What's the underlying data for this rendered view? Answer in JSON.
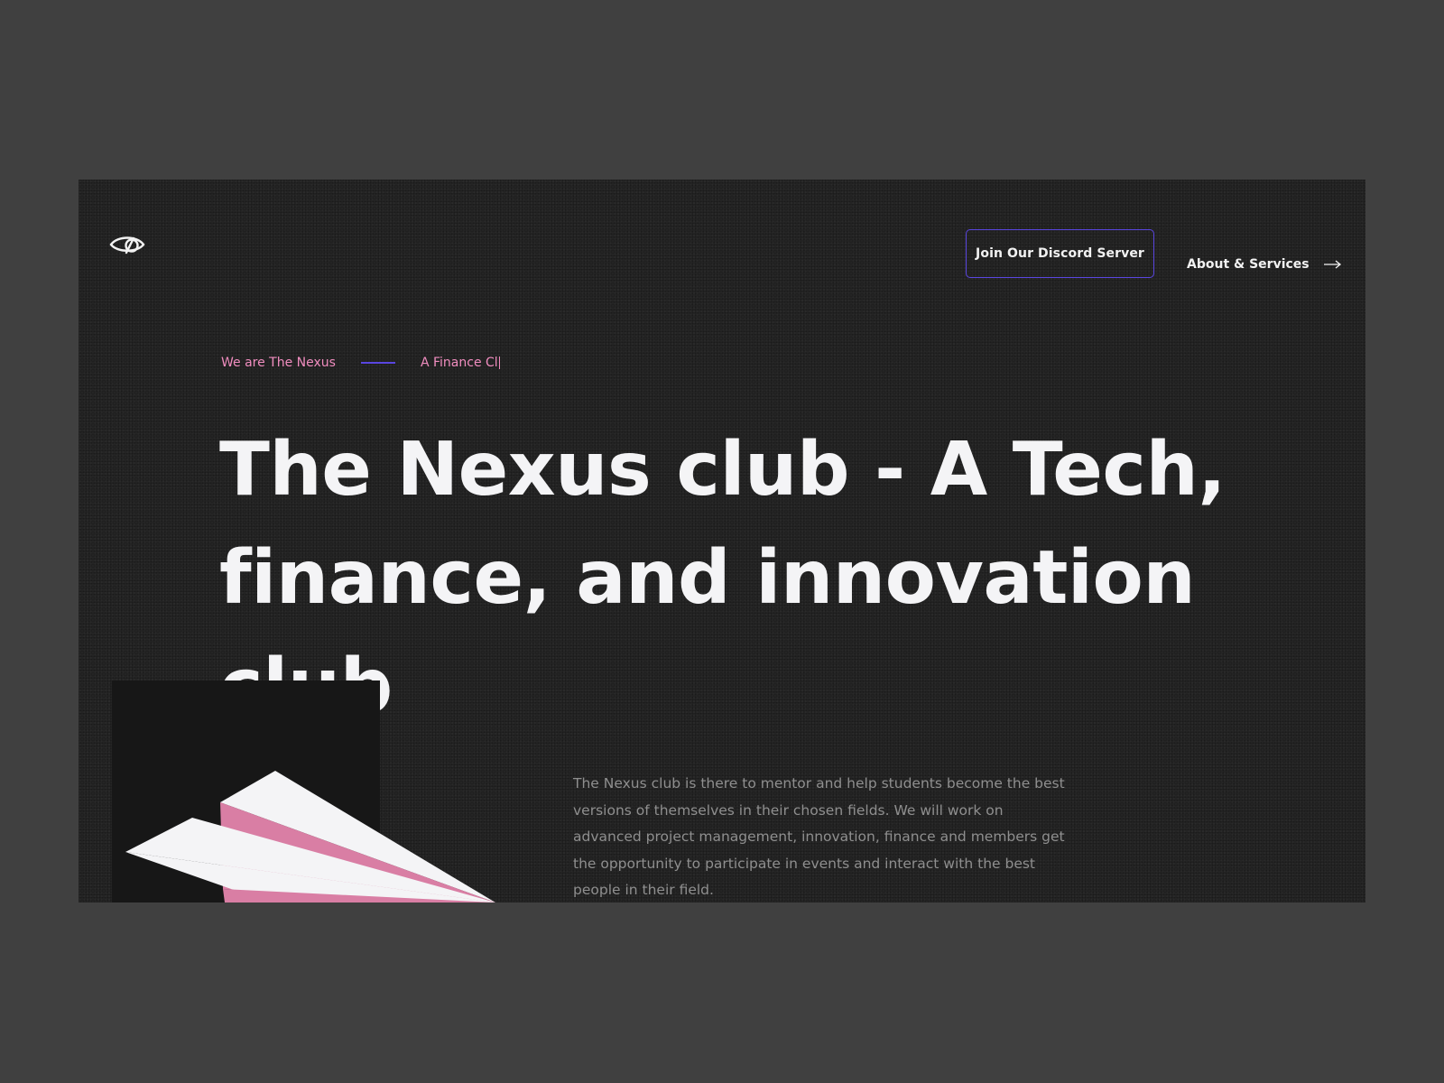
{
  "nav": {
    "discord_label": "Join Our Discord Server",
    "about_label": "About & Services"
  },
  "hero": {
    "tagline_primary": "We are The Nexus",
    "tagline_typing": "A Finance Cl",
    "headline": "The Nexus club - A Tech, finance, and innovation club",
    "description": "The Nexus club is there to mentor and help students become the best versions of themselves in their chosen fields. We will work on advanced project management, innovation, finance and members get the opportunity to participate in events and interact with the best people in their field."
  },
  "colors": {
    "page_background": "#404040",
    "frame_background": "#242424",
    "accent_pink": "#f08dbf",
    "accent_purple": "#5a46e0",
    "headline_text": "#f4f4f6",
    "body_text": "#8f8f8f"
  },
  "icons": {
    "logo": "eye-icon",
    "about_arrow": "arrow-right-icon"
  }
}
